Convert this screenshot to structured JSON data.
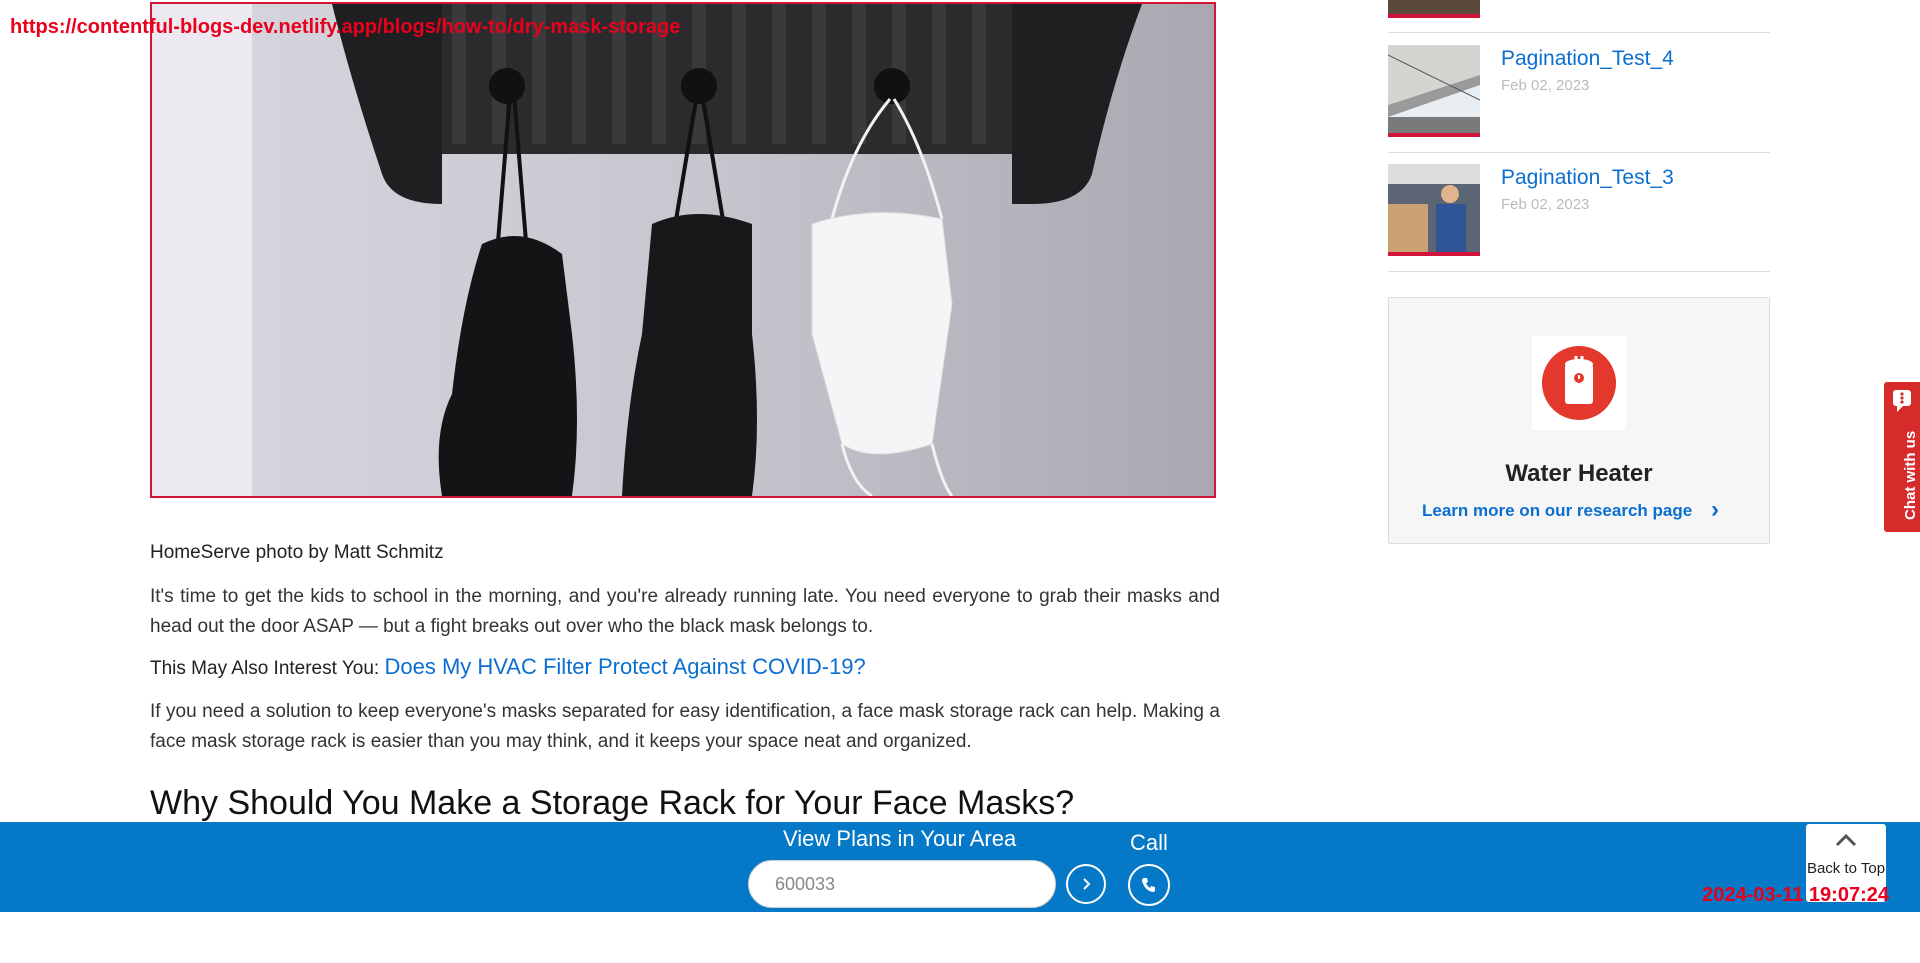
{
  "overlay": {
    "url": "https://contentful-blogs-dev.netlify.app/blogs/how-to/dry-mask-storage",
    "timestamp": "2024-03-11 19:07:24"
  },
  "article": {
    "caption": "HomeServe photo by Matt Schmitz",
    "paragraph1": "It's time to get the kids to school in the morning, and you're already running late. You need everyone to grab their masks and head out the door ASAP — but a fight breaks out over who the black mask belongs to.",
    "interest_label": "This May Also Interest You:",
    "interest_link": "Does My HVAC Filter Protect Against COVID-19?",
    "paragraph2": "If you need a solution to keep everyone's masks separated for easy identification, a face mask storage rack can help. Making a face mask storage rack is easier than you may think, and it keeps your space neat and organized.",
    "heading": "Why Should You Make a Storage Rack for Your Face Masks?"
  },
  "sidebar": {
    "items": [
      {
        "title": "Pagination_Test_4",
        "date": "Feb 02, 2023"
      },
      {
        "title": "Pagination_Test_3",
        "date": "Feb 02, 2023"
      }
    ],
    "card": {
      "title": "Water Heater",
      "link": "Learn more on our research page"
    }
  },
  "chat": {
    "label": "Chat with us"
  },
  "bottom_bar": {
    "plans_label": "View Plans in Your Area",
    "zip_value": "600033",
    "call_label": "Call",
    "back_to_top": "Back to Top"
  },
  "colors": {
    "accent_blue": "#0578c7",
    "link_blue": "#0a6fd1",
    "brand_red": "#d2143a"
  }
}
